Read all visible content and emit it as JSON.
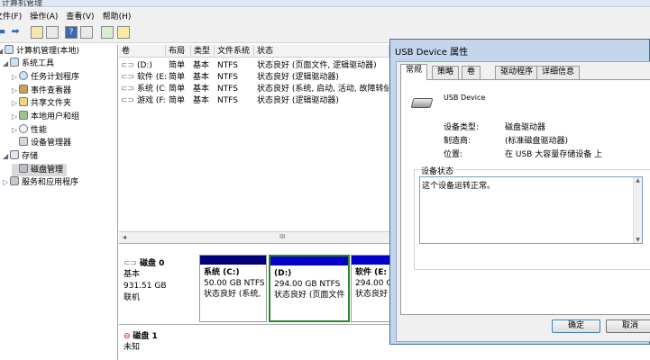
{
  "window": {
    "title_fragment": "计算机管理"
  },
  "menu": {
    "file": "文件(F)",
    "action": "操作(A)",
    "view": "查看(V)",
    "help": "帮助(H)"
  },
  "tree": {
    "root": "计算机管理(本地)",
    "items": [
      {
        "label": "系统工具",
        "icon": "tools-icon"
      },
      {
        "label": "任务计划程序",
        "icon": "clock-icon"
      },
      {
        "label": "事件查看器",
        "icon": "event-viewer-icon"
      },
      {
        "label": "共享文件夹",
        "icon": "shared-folder-icon"
      },
      {
        "label": "本地用户和组",
        "icon": "users-icon"
      },
      {
        "label": "性能",
        "icon": "performance-icon"
      },
      {
        "label": "设备管理器",
        "icon": "device-manager-icon"
      },
      {
        "label": "存储",
        "icon": "storage-icon"
      },
      {
        "label": "磁盘管理",
        "icon": "disk-icon"
      },
      {
        "label": "服务和应用程序",
        "icon": "services-icon"
      }
    ]
  },
  "volumes": {
    "headers": [
      "卷",
      "布局",
      "类型",
      "文件系统",
      "状态"
    ],
    "rows": [
      [
        "(D:)",
        "简单",
        "基本",
        "NTFS",
        "状态良好 (页面文件, 逻辑驱动器)"
      ],
      [
        "软件 (E:)",
        "简单",
        "基本",
        "NTFS",
        "状态良好 (逻辑驱动器)"
      ],
      [
        "系统 (C:)",
        "简单",
        "基本",
        "NTFS",
        "状态良好 (系统, 启动, 活动, 故障转储"
      ],
      [
        "游戏 (F:)",
        "简单",
        "基本",
        "NTFS",
        "状态良好 (逻辑驱动器)"
      ]
    ],
    "scroll_marker": "III"
  },
  "disk0": {
    "name": "磁盘 0",
    "type": "基本",
    "size": "931.51 GB",
    "status": "联机",
    "partitions": [
      {
        "name": "系统 (C:)",
        "size": "50.00 GB NTFS",
        "status": "状态良好 (系统,",
        "bar": "#00007a"
      },
      {
        "name": "(D:)",
        "size": "294.00 GB NTFS",
        "status": "状态良好 (页面文件",
        "bar": "#0000c8"
      },
      {
        "name": "软件 (E:",
        "size": "294.00 GB NTF",
        "status": "状态良好 (逻",
        "bar": "#0000c8"
      }
    ]
  },
  "disk1": {
    "name": "磁盘 1",
    "status": "未知"
  },
  "dialog": {
    "title": "USB Device 属性",
    "tabs": [
      "常规",
      "策略",
      "卷",
      "驱动程序",
      "详细信息"
    ],
    "device_name": "USB Device",
    "fields": [
      {
        "label": "设备类型:",
        "value": "磁盘驱动器"
      },
      {
        "label": "制造商:",
        "value": "(标准磁盘驱动器)"
      },
      {
        "label": "位置:",
        "value": "在 USB 大容量存储设备 上"
      }
    ],
    "status_group": "设备状态",
    "status_text": "这个设备运转正常。",
    "ok": "确定",
    "cancel": "取消"
  }
}
